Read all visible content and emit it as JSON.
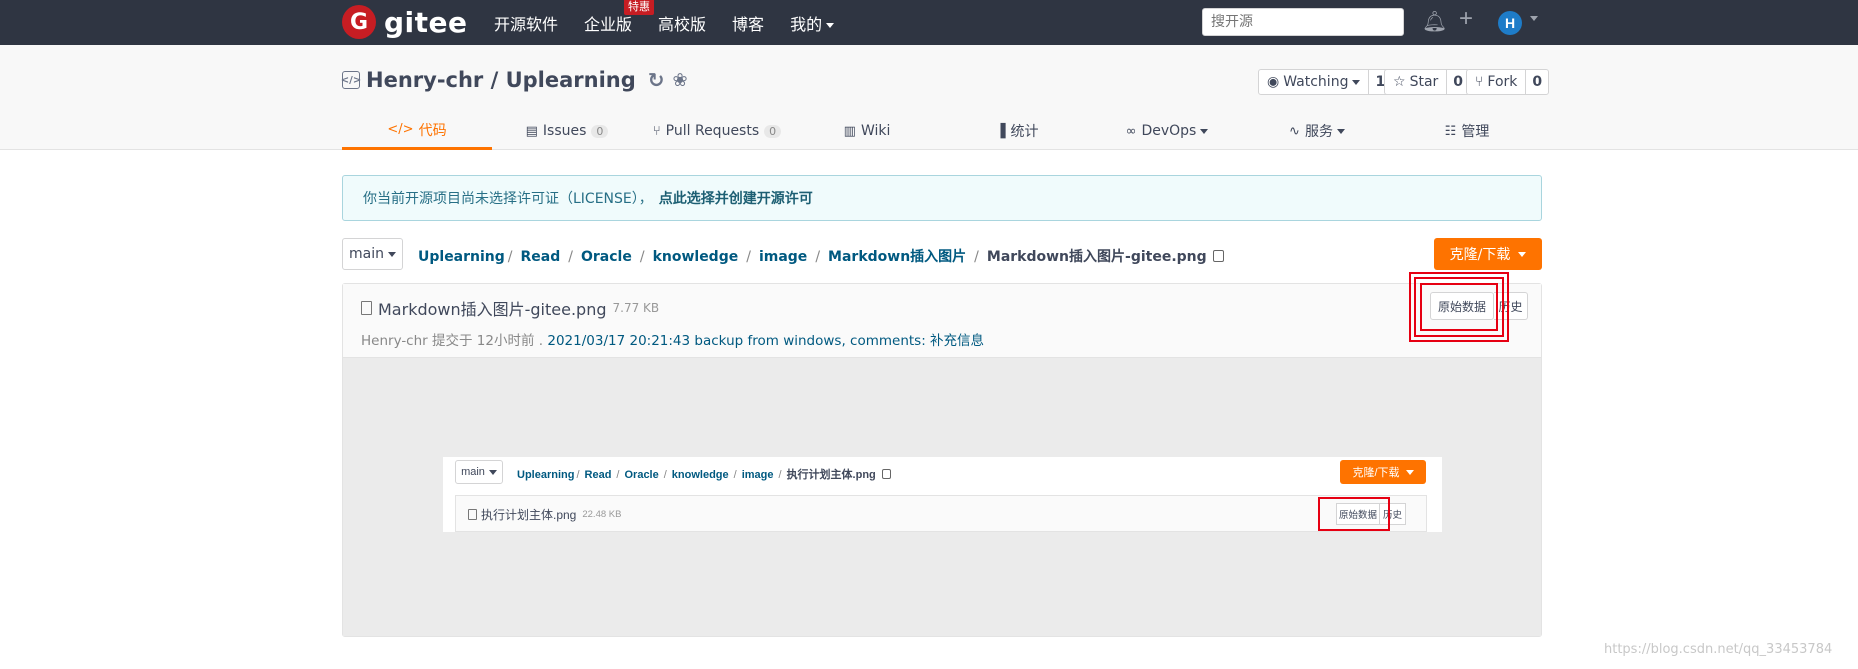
{
  "topbar": {
    "logo_text": "gitee",
    "nav": [
      {
        "label": "开源软件"
      },
      {
        "label": "企业版",
        "badge": "特惠"
      },
      {
        "label": "高校版"
      },
      {
        "label": "博客"
      },
      {
        "label": "我的"
      }
    ],
    "search_placeholder": "搜开源",
    "avatar_initial": "H"
  },
  "project": {
    "title": "Henry-chr / Uplearning",
    "watching_label": "Watching",
    "watching_count": "1",
    "star_label": "Star",
    "star_count": "0",
    "fork_label": "Fork",
    "fork_count": "0"
  },
  "tabs": [
    {
      "label": "代码",
      "active": true
    },
    {
      "label": "Issues",
      "count": "0"
    },
    {
      "label": "Pull Requests",
      "count": "0"
    },
    {
      "label": "Wiki"
    },
    {
      "label": "统计"
    },
    {
      "label": "DevOps"
    },
    {
      "label": "服务"
    },
    {
      "label": "管理"
    }
  ],
  "notice": {
    "text": "你当前开源项目尚未选择许可证（LICENSE），",
    "link": "点此选择并创建开源许可"
  },
  "branch": "main",
  "breadcrumb": [
    "Uplearning",
    "Read",
    "Oracle",
    "knowledge",
    "image",
    "Markdown插入图片",
    "Markdown插入图片-gitee.png"
  ],
  "clone_label": "克隆/下载",
  "file": {
    "name": "Markdown插入图片-gitee.png",
    "size": "7.77 KB",
    "commit_author": "Henry-chr",
    "commit_meta": "提交于 12小时前 .",
    "commit_message": "2021/03/17 20:21:43 backup from windows, comments: 补充信息",
    "raw_label": "原始数据",
    "history_label": "历史"
  },
  "embedded": {
    "branch": "main",
    "breadcrumb": [
      "Uplearning",
      "Read",
      "Oracle",
      "knowledge",
      "image",
      "执行计划主体.png"
    ],
    "clone_label": "克隆/下载",
    "file_name": "执行计划主体.png",
    "file_size": "22.48 KB",
    "raw_label": "原始数据",
    "history_label": "历史"
  },
  "watermark": "https://blog.csdn.net/qq_33453784",
  "colors": {
    "accent": "#fe7300",
    "topbar": "#2f3542",
    "link": "#005980",
    "highlight": "#e60012"
  }
}
